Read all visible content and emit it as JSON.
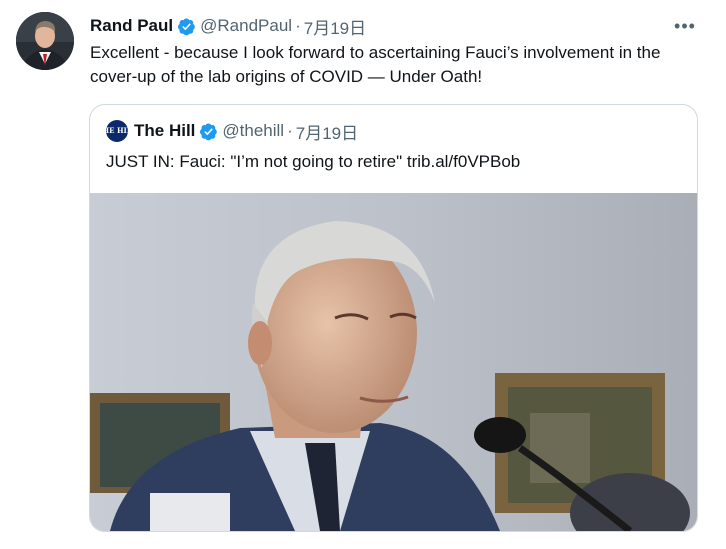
{
  "tweet": {
    "author_name": "Rand Paul",
    "handle": "@RandPaul",
    "separator": "·",
    "date": "7月19日",
    "more_label": "•••",
    "text": "Excellent - because I look forward to ascertaining Fauci’s involvement in the cover-up of the lab origins of COVID — Under Oath!",
    "avatar_icon": "senator-portrait-avatar",
    "verified_icon": "verified-badge-icon"
  },
  "quoted_tweet": {
    "author_name": "The Hill",
    "handle": "@thehill",
    "separator": "·",
    "date": "7月19日",
    "avatar_text": "THE HILL",
    "text": "JUST IN: Fauci: \"I’m not going to retire\" trib.al/f0VPBob",
    "photo_icon": "press-photo-older-man-at-microphone"
  },
  "colors": {
    "verified_blue": "#1d9bf0",
    "text_primary": "#0f1419",
    "text_secondary": "#536471",
    "border": "#cfd9de"
  }
}
